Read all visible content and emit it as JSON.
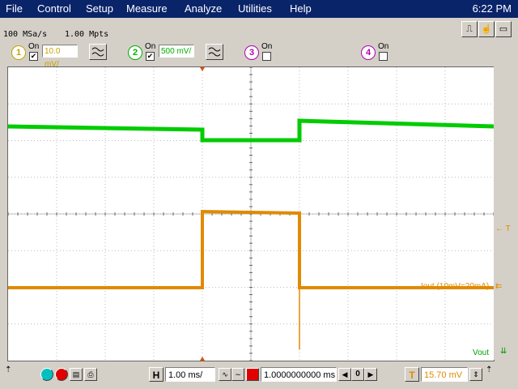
{
  "menu": [
    "File",
    "Control",
    "Setup",
    "Measure",
    "Analyze",
    "Utilities",
    "Help"
  ],
  "clock": "6:22 PM",
  "acquisition": {
    "sample_rate": "100 MSa/s",
    "memory": "1.00 Mpts"
  },
  "channels": [
    {
      "number": "1",
      "on_label": "On",
      "checked": true,
      "scale": "10.0 mV/",
      "color": "#c8a000"
    },
    {
      "number": "2",
      "on_label": "On",
      "checked": true,
      "scale": "500 mV/",
      "color": "#00b000"
    },
    {
      "number": "3",
      "on_label": "On",
      "checked": false,
      "color": "#b000b0"
    },
    {
      "number": "4",
      "on_label": "On",
      "checked": false,
      "color": "#b000b0"
    }
  ],
  "markers": {
    "trigger_label": "← T",
    "iout_label": "Iout (10mV=20mA)",
    "vout_label": "Vout"
  },
  "bottom": {
    "h_label": "H",
    "timebase": "1.00 ms/",
    "delay": "1.0000000000 ms",
    "delay_step": "0",
    "trigger_label": "T",
    "trigger_level": "15.70 mV"
  },
  "colors": {
    "vout": "#00cc00",
    "iout": "#e08a00"
  }
}
